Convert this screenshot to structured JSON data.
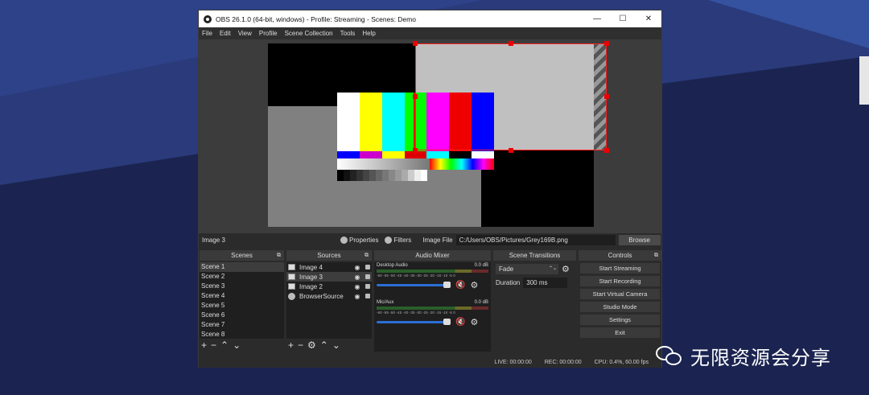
{
  "window": {
    "title": "OBS 26.1.0 (64-bit, windows) - Profile: Streaming - Scenes: Demo",
    "controls": [
      "—",
      "☐",
      "✕"
    ]
  },
  "menu": [
    "File",
    "Edit",
    "View",
    "Profile",
    "Scene Collection",
    "Tools",
    "Help"
  ],
  "source_toolbar": {
    "selected_source": "Image 3",
    "properties_label": "Properties",
    "filters_label": "Filters",
    "image_file_label": "Image File",
    "image_file_path": "C:/Users/OBS/Pictures/Grey169B.png",
    "browse_label": "Browse"
  },
  "scenes": {
    "title": "Scenes",
    "items": [
      "Scene 1",
      "Scene 2",
      "Scene 3",
      "Scene 4",
      "Scene 5",
      "Scene 6",
      "Scene 7",
      "Scene 8"
    ],
    "selected": 0
  },
  "sources": {
    "title": "Sources",
    "items": [
      {
        "name": "Image 4",
        "icon": "image-icon"
      },
      {
        "name": "Image 3",
        "icon": "image-icon"
      },
      {
        "name": "Image 2",
        "icon": "image-icon"
      },
      {
        "name": "BrowserSource",
        "icon": "globe-icon"
      }
    ],
    "selected": 1
  },
  "mixer": {
    "title": "Audio Mixer",
    "channels": [
      {
        "name": "Desktop Audio",
        "level": "0.0 dB",
        "volume": 1.0
      },
      {
        "name": "Mic/Aux",
        "level": "0.0 dB",
        "volume": 1.0
      }
    ],
    "scale": "-60 -55 -50 -45 -40 -35 -30 -25 -20 -15 -10 -5 0"
  },
  "transitions": {
    "title": "Scene Transitions",
    "selected": "Fade",
    "duration_label": "Duration",
    "duration": "300 ms"
  },
  "controls": {
    "title": "Controls",
    "buttons": [
      "Start Streaming",
      "Start Recording",
      "Start Virtual Camera",
      "Studio Mode",
      "Settings",
      "Exit"
    ]
  },
  "status": {
    "live": "LIVE: 00:00:00",
    "rec": "REC: 00:00:00",
    "cpu": "CPU: 0.4%, 60.00 fps"
  },
  "watermark": {
    "text": "无限资源会分享"
  },
  "colors": {
    "desktop_bg": "#1b2450",
    "selection": "#ff2020",
    "accent_slider": "#2a6ed6"
  }
}
